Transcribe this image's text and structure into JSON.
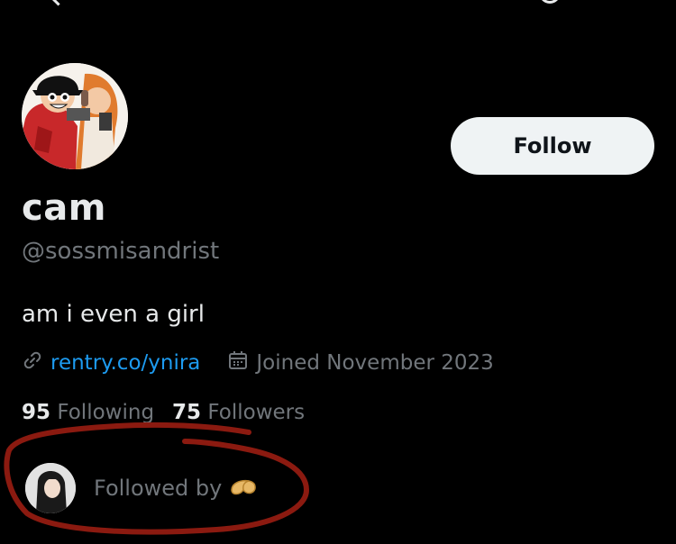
{
  "profile": {
    "name": "cam",
    "handle": "@sossmisandrist",
    "bio": "am i even a girl",
    "link": "rentry.co/ynira",
    "joined": "Joined November 2023",
    "following_count": "95",
    "following_label": "Following",
    "followers_count": "75",
    "followers_label": "Followers"
  },
  "actions": {
    "follow_label": "Follow"
  },
  "followed_by": {
    "label": "Followed by"
  },
  "colors": {
    "background": "#000000",
    "link": "#1d9bf0",
    "muted": "#71767b",
    "annotation": "#8b1a10"
  },
  "icons": [
    "back-arrow-icon",
    "search-icon",
    "link-icon",
    "calendar-icon",
    "fortune-cookie-icon"
  ]
}
